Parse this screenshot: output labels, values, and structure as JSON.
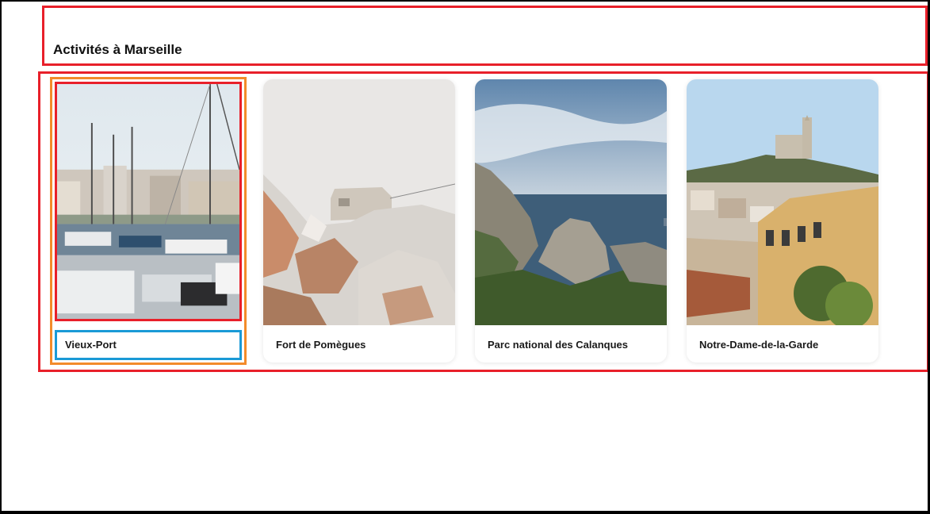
{
  "section": {
    "title": "Activités à Marseille"
  },
  "activities": [
    {
      "name": "Vieux-Port",
      "photo": "harbor-sailboats-photo"
    },
    {
      "name": "Fort de Pomègues",
      "photo": "rocky-island-fort-photo"
    },
    {
      "name": "Parc national des Calanques",
      "photo": "coastal-cliffs-sea-photo"
    },
    {
      "name": "Notre-Dame-de-la-Garde",
      "photo": "hilltop-basilica-city-photo"
    }
  ],
  "colors": {
    "highlight_red": "#e8202a",
    "highlight_orange": "#f38b2a",
    "highlight_blue": "#1a9ad6"
  }
}
